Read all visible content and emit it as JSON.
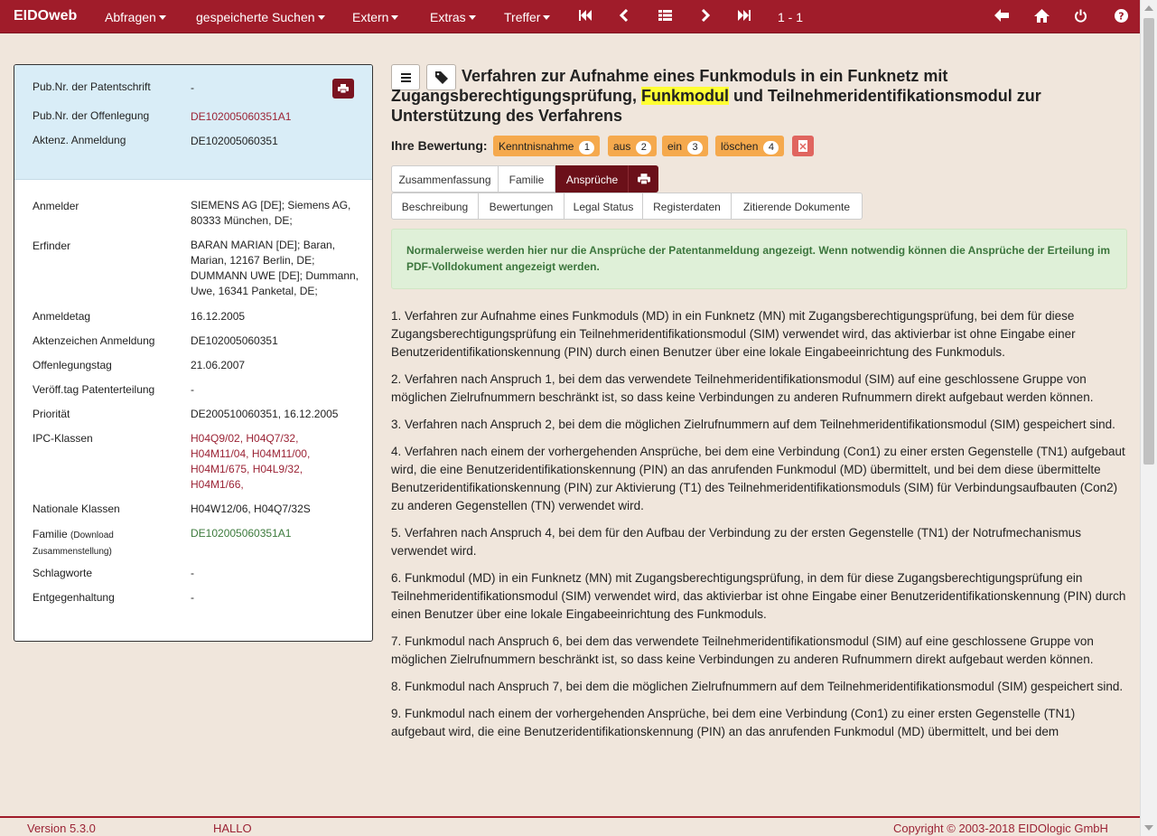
{
  "nav": {
    "brand": "EIDOweb",
    "menus": [
      {
        "label": "Abfragen"
      },
      {
        "label": "gespeicherte Suchen"
      },
      {
        "label": "Extern"
      },
      {
        "label": "Extras"
      },
      {
        "label": "Treffer"
      }
    ],
    "counter": "1 - 1"
  },
  "left_top": [
    {
      "label": "Pub.Nr. der Patentschrift",
      "value": "-"
    },
    {
      "label": "Pub.Nr. der Offenlegung",
      "value": "DE102005060351A1"
    },
    {
      "label": "Aktenz. Anmeldung",
      "value": "DE102005060351"
    }
  ],
  "details": {
    "anmelder_label": "Anmelder",
    "anmelder_value": "SIEMENS AG [DE]; Siemens AG, 80333 München, DE;",
    "erfinder_label": "Erfinder",
    "erfinder_value": "BARAN MARIAN [DE]; Baran, Marian, 12167 Berlin, DE; DUMMANN UWE [DE]; Dummann, Uwe, 16341 Panketal, DE;",
    "anmeldetag_label": "Anmeldetag",
    "anmeldetag_value": "16.12.2005",
    "aktenzeichen_label": "Aktenzeichen Anmeldung",
    "aktenzeichen_value": "DE102005060351",
    "offenlegungstag_label": "Offenlegungstag",
    "offenlegungstag_value": "21.06.2007",
    "erteilung_label": "Veröff.tag Patenterteilung",
    "erteilung_value": "-",
    "prioritaet_label": "Priorität",
    "prioritaet_value": "DE200510060351, 16.12.2005",
    "ipc_label": "IPC-Klassen",
    "ipc_line1": "H04Q9/02, H04Q7/32,",
    "ipc_line2": "H04M11/04, H04M11/00,",
    "ipc_line3": "H04M1/675, H04L9/32,",
    "ipc_line4": "H04M1/66,",
    "nationale_label": "Nationale Klassen",
    "nationale_value": "H04W12/06, H04Q7/32S",
    "familie_label": "Familie",
    "familie_sub": "(Download Zusammenstellung)",
    "familie_value": "DE102005060351A1",
    "schlagworte_label": "Schlagworte",
    "schlagworte_value": "-",
    "entgegen_label": "Entgegenhaltung",
    "entgegen_value": "-"
  },
  "title": {
    "part1": "Verfahren zur Aufnahme eines Funkmoduls in ein Funknetz mit Zugangsberechtigungsprüfung,",
    "highlight": "Funkmodul",
    "part2": "und Teilnehmeridentifikationsmodul zur Unterstützung des Verfahrens"
  },
  "rating": {
    "label": "Ihre Bewertung:",
    "buttons": [
      {
        "label": "Kenntnisnahme",
        "count": "1"
      },
      {
        "label": "aus",
        "count": "2"
      },
      {
        "label": "ein",
        "count": "3"
      },
      {
        "label": "löschen",
        "count": "4"
      }
    ]
  },
  "tabs_row1": [
    "Zusammenfassung",
    "Familie",
    "Ansprüche"
  ],
  "tabs_row2": [
    "Beschreibung",
    "Bewertungen",
    "Legal Status",
    "Registerdaten",
    "Zitierende Dokumente"
  ],
  "alert": "Normalerweise werden hier nur die Ansprüche der Patentanmeldung angezeigt. Wenn notwendig können die Ansprüche der Erteilung im PDF-Volldokument angezeigt werden.",
  "claims": [
    "1. Verfahren zur Aufnahme eines Funkmoduls (MD) in ein Funknetz (MN) mit Zugangsberechtigungsprüfung, bei dem für diese Zugangsberechtigungsprüfung ein Teilnehmeridentifikationsmodul (SIM) verwendet wird, das aktivierbar ist ohne Eingabe einer Benutzeridentifikationskennung (PIN) durch einen Benutzer über eine lokale Eingabeeinrichtung des Funkmoduls.",
    "2. Verfahren nach Anspruch 1, bei dem das verwendete Teilnehmeridentifikationsmodul (SIM) auf eine geschlossene Gruppe von möglichen Zielrufnummern beschränkt ist, so dass keine Verbindungen zu anderen Rufnummern direkt aufgebaut werden können.",
    "3. Verfahren nach Anspruch 2, bei dem die möglichen Zielrufnummern auf dem Teilnehmeridentifikationsmodul (SIM) gespeichert sind.",
    "4. Verfahren nach einem der vorhergehenden Ansprüche, bei dem eine Verbindung (Con1) zu einer ersten Gegenstelle (TN1) aufgebaut wird, die eine Benutzeridentifikationskennung (PIN) an das anrufenden Funkmodul (MD) übermittelt, und bei dem diese übermittelte Benutzeridentifikationskennung (PIN) zur Aktivierung (T1) des Teilnehmeridentifikationsmoduls (SIM) für Verbindungsaufbauten (Con2) zu anderen Gegenstellen (TN) verwendet wird.",
    "5. Verfahren nach Anspruch 4, bei dem für den Aufbau der Verbindung zu der ersten Gegenstelle (TN1) der Notrufmechanismus verwendet wird.",
    "6. Funkmodul (MD) in ein Funknetz (MN) mit Zugangsberechtigungsprüfung, in dem für diese Zugangsberechtigungsprüfung ein Teilnehmeridentifikationsmodul (SIM) verwendet wird, das aktivierbar ist ohne Eingabe einer Benutzeridentifikationskennung (PIN) durch einen Benutzer über eine lokale Eingabeeinrichtung des Funkmoduls.",
    "7. Funkmodul nach Anspruch 6, bei dem das verwendete Teilnehmeridentifikationsmodul (SIM) auf eine geschlossene Gruppe von möglichen Zielrufnummern beschränkt ist, so dass keine Verbindungen zu anderen Rufnummern direkt aufgebaut werden können.",
    "8. Funkmodul nach Anspruch 7, bei dem die möglichen Zielrufnummern auf dem Teilnehmeridentifikationsmodul (SIM) gespeichert sind.",
    "9. Funkmodul nach einem der vorhergehenden Ansprüche, bei dem eine Verbindung (Con1) zu einer ersten Gegenstelle (TN1) aufgebaut wird, die eine Benutzeridentifikationskennung (PIN) an das anrufenden Funkmodul (MD) übermittelt, und bei dem"
  ],
  "footer": {
    "version": "Version 5.3.0",
    "user": "HALLO",
    "copyright": "Copyright © 2003-2018 EIDOlogic GmbH"
  },
  "colors": {
    "navbar": "#a01c2a",
    "active_tab": "#6b1019",
    "rating_button": "#f5a94d",
    "alert_bg": "#dff0d8",
    "page_bg": "#f0e6dc",
    "info_bg": "#d9edf7"
  },
  "icons": [
    "skip-first-icon",
    "prev-icon",
    "list-icon",
    "next-icon",
    "skip-last-icon",
    "back-arrow-icon",
    "home-icon",
    "power-icon",
    "help-icon",
    "printer-icon",
    "menu-icon",
    "tag-icon",
    "delete-rating-icon"
  ]
}
